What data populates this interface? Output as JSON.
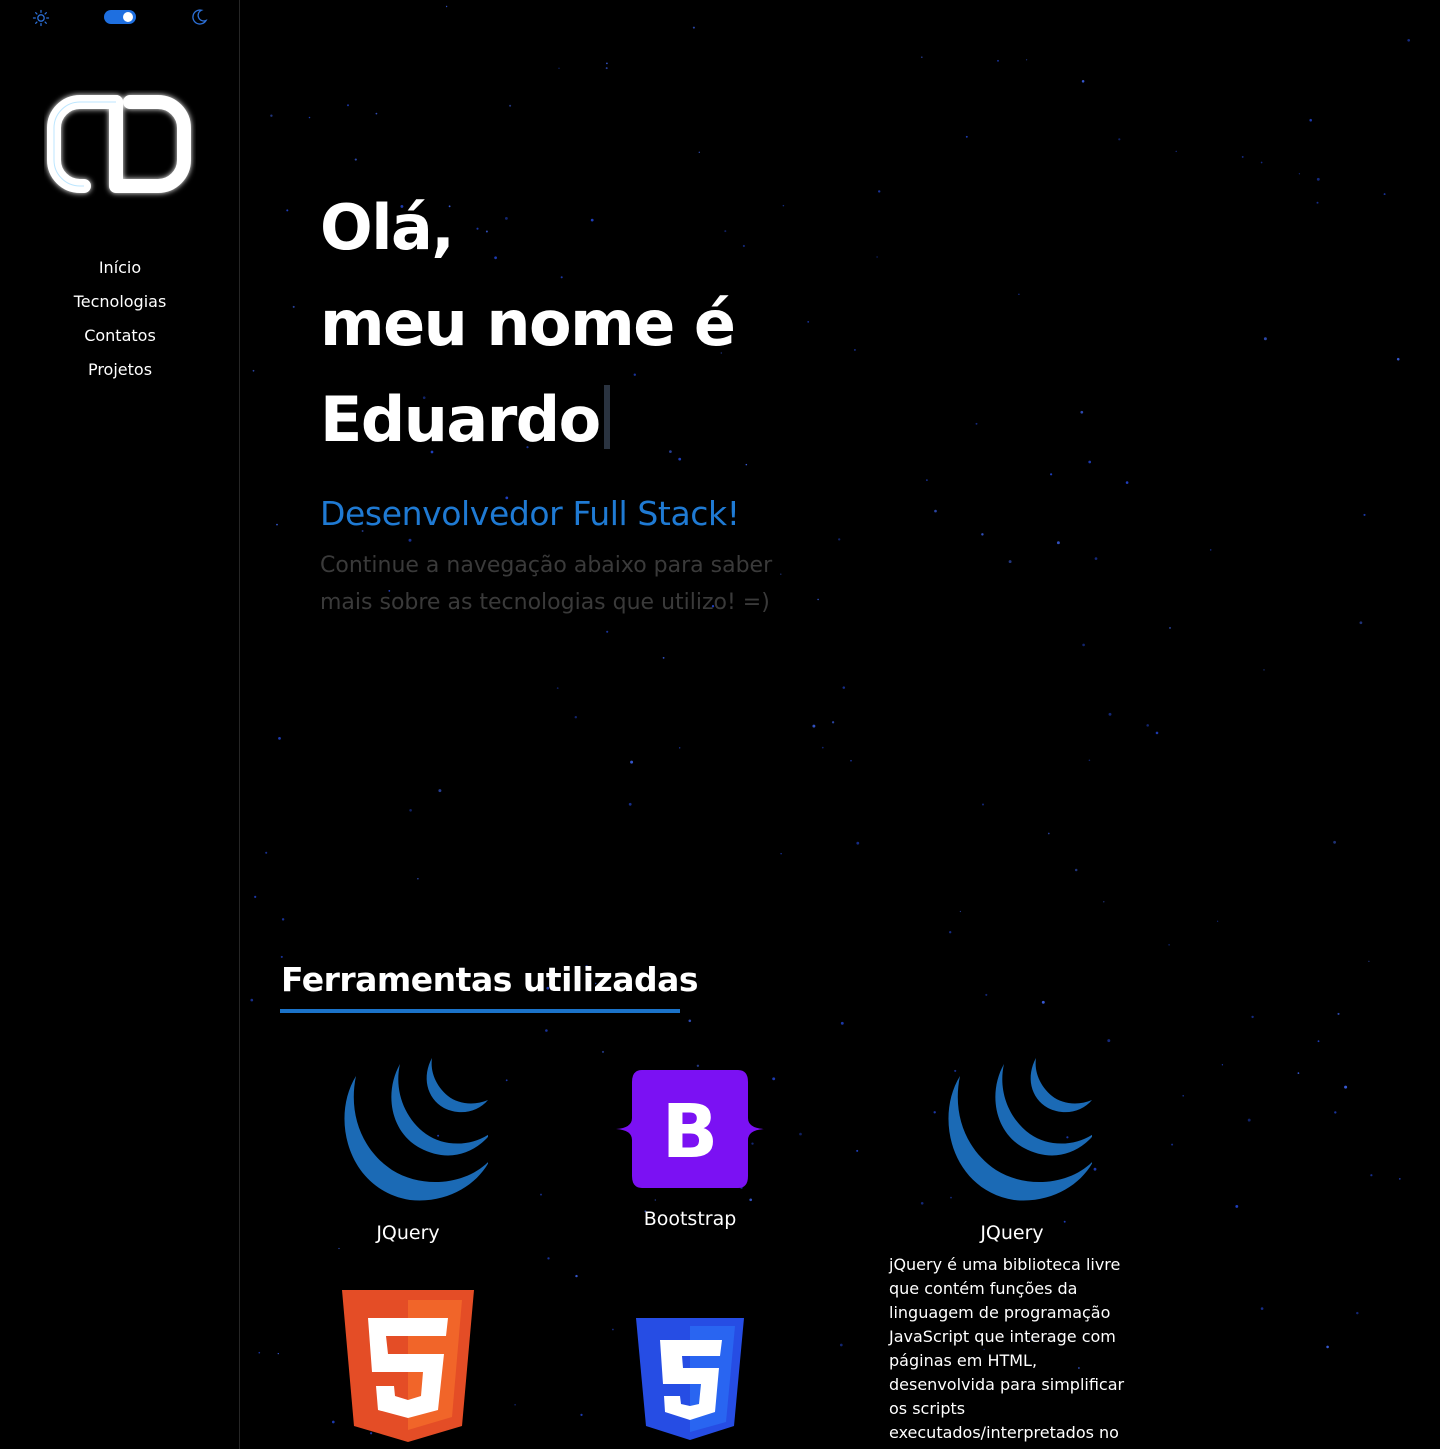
{
  "theme": {
    "dark_mode": true,
    "accent": "#1e6fe0",
    "icons": [
      "sun-icon",
      "moon-icon"
    ]
  },
  "sidebar": {
    "logo": "ED-logo",
    "nav": [
      {
        "label": "Início"
      },
      {
        "label": "Tecnologias"
      },
      {
        "label": "Contatos"
      },
      {
        "label": "Projetos"
      }
    ]
  },
  "hero": {
    "line1": "Olá,",
    "line2": "meu nome é",
    "line3": "Eduardo",
    "subtitle": "Desenvolvedor Full Stack!",
    "description": "Continue a navegação abaixo para saber mais sobre as tecnologias que utilizo! =)"
  },
  "tools": {
    "title": "Ferramentas utilizadas",
    "items": [
      {
        "name": "JQuery",
        "icon": "jquery-icon"
      },
      {
        "name": "Bootstrap",
        "icon": "bootstrap-icon"
      },
      {
        "name": "JQuery",
        "icon": "jquery-icon",
        "description": "jQuery é uma biblioteca livre que contém funções da linguagem de programação JavaScript que interage com páginas em HTML, desenvolvida para simplificar os scripts executados/interpretados no"
      },
      {
        "name": "HTML5",
        "icon": "html5-icon"
      },
      {
        "name": "CSS3",
        "icon": "css3-icon"
      }
    ]
  }
}
